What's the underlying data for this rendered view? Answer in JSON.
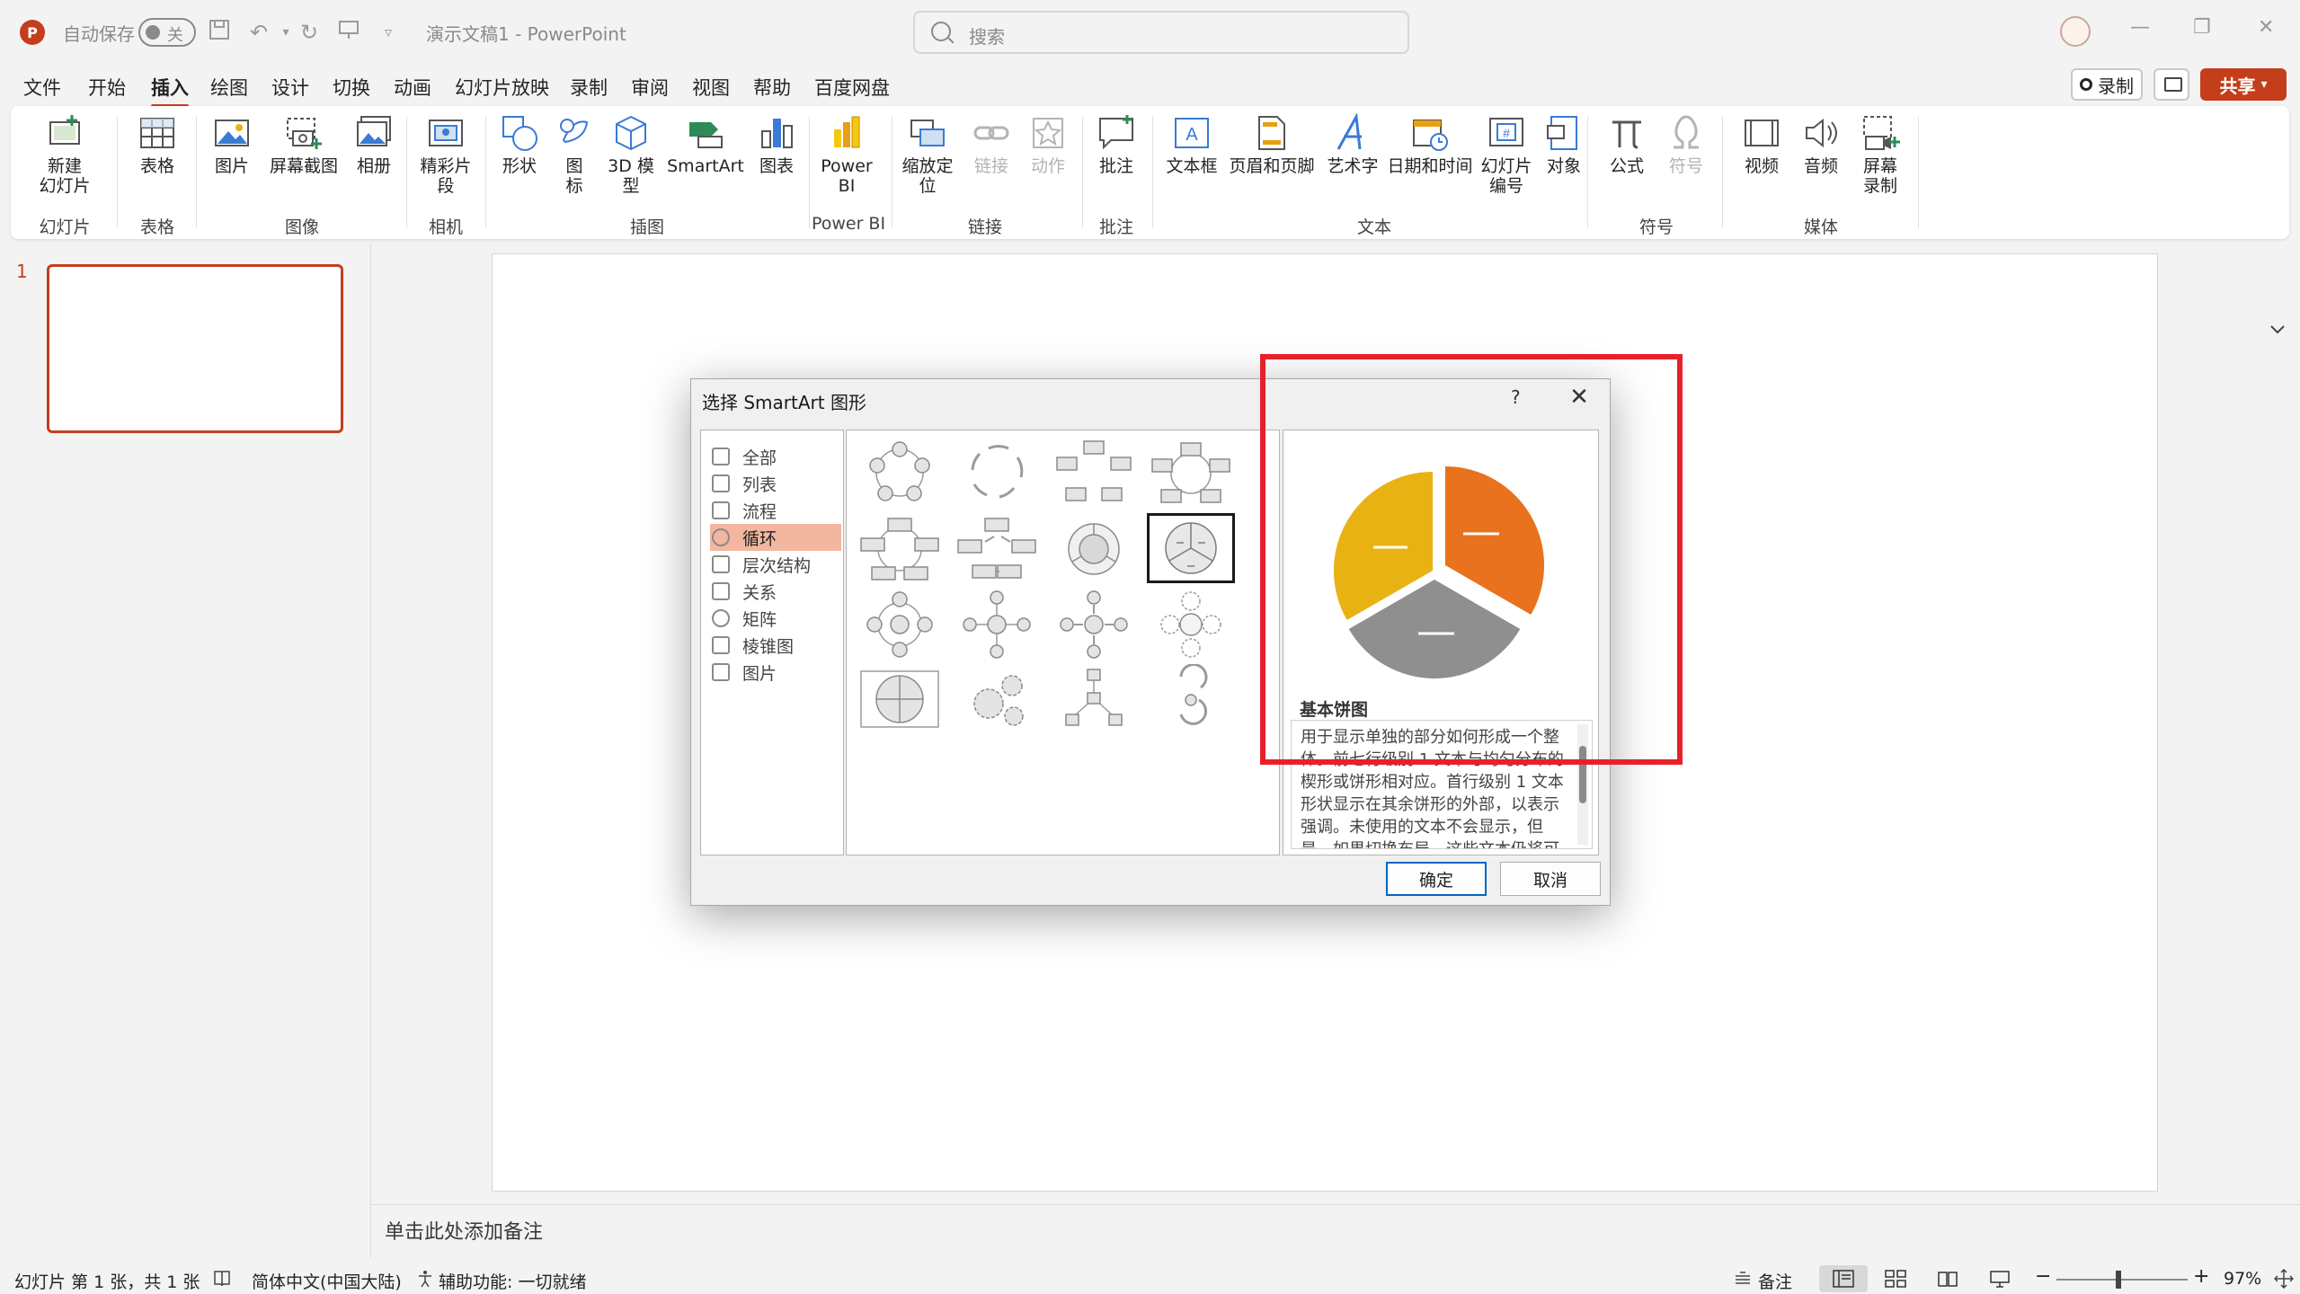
{
  "titlebar": {
    "app_logo": "P",
    "autosave_label": "自动保存",
    "autosave_state": "关",
    "doc_title": "演示文稿1 - PowerPoint",
    "search_placeholder": "搜索"
  },
  "menu": {
    "tabs": [
      "文件",
      "开始",
      "插入",
      "绘图",
      "设计",
      "切换",
      "动画",
      "幻灯片放映",
      "录制",
      "审阅",
      "视图",
      "帮助",
      "百度网盘"
    ],
    "active_tab": "插入",
    "record_label": "录制",
    "share_label": "共享"
  },
  "ribbon": {
    "items": {
      "new_slide": "新建\n幻灯片",
      "table": "表格",
      "picture": "图片",
      "screenshot": "屏幕截图",
      "album": "相册",
      "cameo": "精彩片\n段",
      "shapes": "形状",
      "icons": "图\n标",
      "model3d": "3D 模\n型",
      "smartart": "SmartArt",
      "chart": "图表",
      "powerbi": "Power\nBI",
      "zoom": "缩放定\n位",
      "link": "链接",
      "action": "动作",
      "comment": "批注",
      "textbox": "文本框",
      "header_footer": "页眉和页脚",
      "wordart": "艺术字",
      "datetime": "日期和时间",
      "slide_number": "幻灯片\n编号",
      "object": "对象",
      "equation": "公式",
      "symbol": "符号",
      "video": "视频",
      "audio": "音频",
      "screen_recording": "屏幕\n录制"
    },
    "groups": {
      "slides": "幻灯片",
      "tables": "表格",
      "images": "图像",
      "camera": "相机",
      "illustrations": "插图",
      "powerbi": "Power BI",
      "links": "链接",
      "comments": "批注",
      "text": "文本",
      "symbols": "符号",
      "media": "媒体"
    }
  },
  "slides_panel": {
    "slide_number": "1"
  },
  "notes": {
    "placeholder": "单击此处添加备注"
  },
  "statusbar": {
    "slide_info": "幻灯片 第 1 张，共 1 张",
    "language": "简体中文(中国大陆)",
    "accessibility": "辅助功能: 一切就绪",
    "notes_label": "备注",
    "zoom_level": "97%"
  },
  "dialog": {
    "title": "选择 SmartArt 图形",
    "help": "?",
    "categories": [
      "全部",
      "列表",
      "流程",
      "循环",
      "层次结构",
      "关系",
      "矩阵",
      "棱锥图",
      "图片"
    ],
    "selected_category": "循环",
    "preview_title": "基本饼图",
    "preview_description": "用于显示单独的部分如何形成一个整体。前七行级别 1 文本与均匀分布的楔形或饼形相对应。首行级别 1 文本形状显示在其余饼形的外部，以表示强调。未使用的文本不会显示，但是，如果切换布局，这些文本仍将可用。",
    "ok_label": "确定",
    "cancel_label": "取消",
    "colors": {
      "pie_yellow": "#e9b213",
      "pie_orange": "#e8721d",
      "pie_gray": "#8f8f8f"
    }
  },
  "annotation": {
    "color": "#e8202a"
  }
}
